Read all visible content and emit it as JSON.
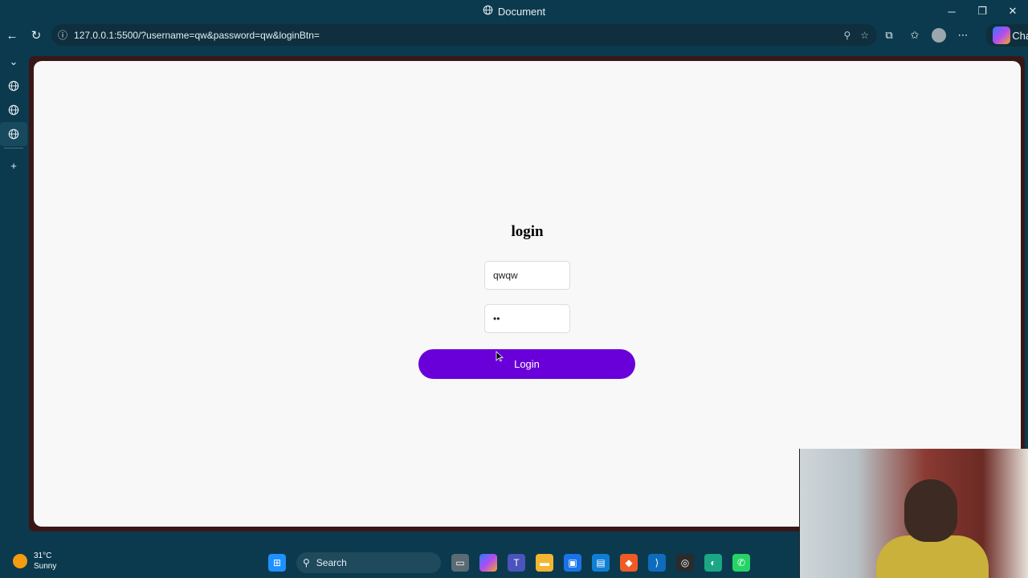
{
  "window": {
    "title": "Document",
    "controls": {
      "minimize": "─",
      "restore": "❐",
      "close": "✕"
    }
  },
  "nav": {
    "back_icon": "←",
    "refresh_icon": "↻",
    "url": "127.0.0.1:5500/?username=qw&password=qw&loginBtn=",
    "info_icon": "ⓘ",
    "chat_label": "Chat"
  },
  "sidebar": {
    "items": [
      {
        "icon": "chevron-down-icon",
        "glyph": "⌄"
      },
      {
        "icon": "globe-icon",
        "glyph": "🌐"
      },
      {
        "icon": "globe-icon",
        "glyph": "🌐"
      },
      {
        "icon": "globe-icon",
        "glyph": "🌐"
      },
      {
        "icon": "plus-icon",
        "glyph": "+"
      }
    ]
  },
  "page": {
    "heading": "login",
    "username_value": "qwqw",
    "password_value": "••",
    "login_button": "Login"
  },
  "taskbar": {
    "temperature": "31°C",
    "condition": "Sunny",
    "search_placeholder": "Search"
  },
  "colors": {
    "accent_button": "#6a00d9",
    "chrome_background": "#0b3a4e"
  }
}
